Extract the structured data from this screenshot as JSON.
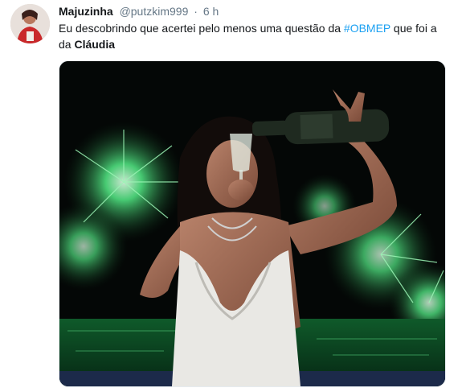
{
  "tweet": {
    "author_name": "Majuzinha",
    "handle": "@putzkim999",
    "separator": "·",
    "time": "6 h",
    "text_before_hashtag": "Eu descobrindo que acertei pelo menos uma questão da ",
    "hashtag": "#OBMEP",
    "text_after_hashtag": " que foi a da ",
    "text_bold_end": "Cláudia",
    "avatar_icon": "profile-photo",
    "media_icon": "photo-woman-pouring-champagne-fireworks"
  },
  "colors": {
    "hashtag": "#1da1f2",
    "secondary_text": "#657786",
    "fireworks": "#2fd06a"
  }
}
